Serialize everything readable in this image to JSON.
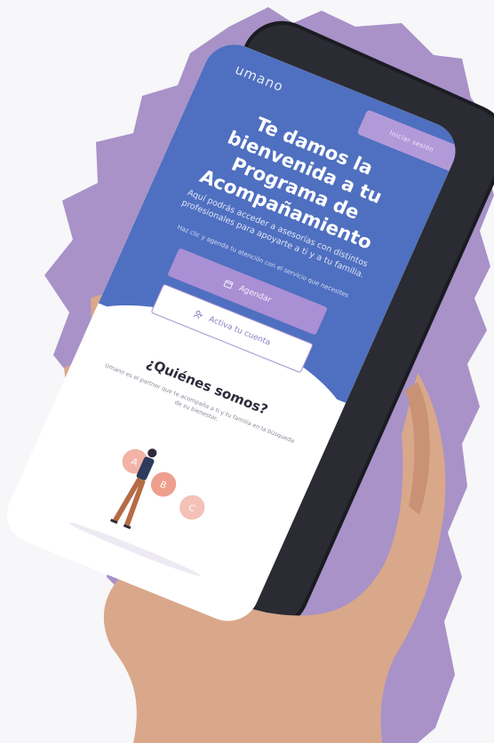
{
  "screen": {
    "logo": "umano",
    "login_button": "Iniciar sesión",
    "title": "Te damos la bienvenida a tu Programa de Acompañamiento",
    "description": "Aquí podrás acceder a asesorías con distintos profesionales para apoyarte a ti y a tu familia.",
    "hint": "Haz clic y agenda tu atención con el servicio que necesites",
    "agenda_button": "Agendar",
    "activa_button": "Activa tu cuenta",
    "section_title": "¿Quiénes somos?",
    "section_text": "Umano es el partner que te acompaña a ti y tu familia en la búsqueda de su bienestar.",
    "illustration_letters": [
      "A",
      "B",
      "C"
    ]
  },
  "colors": {
    "blob": "#a892c8",
    "hero": "#4f6fc0",
    "accent": "#a98fd4",
    "phone_frame": "#1b1c22"
  },
  "icons": {
    "agenda": "calendar-icon",
    "activa": "user-add-icon"
  }
}
